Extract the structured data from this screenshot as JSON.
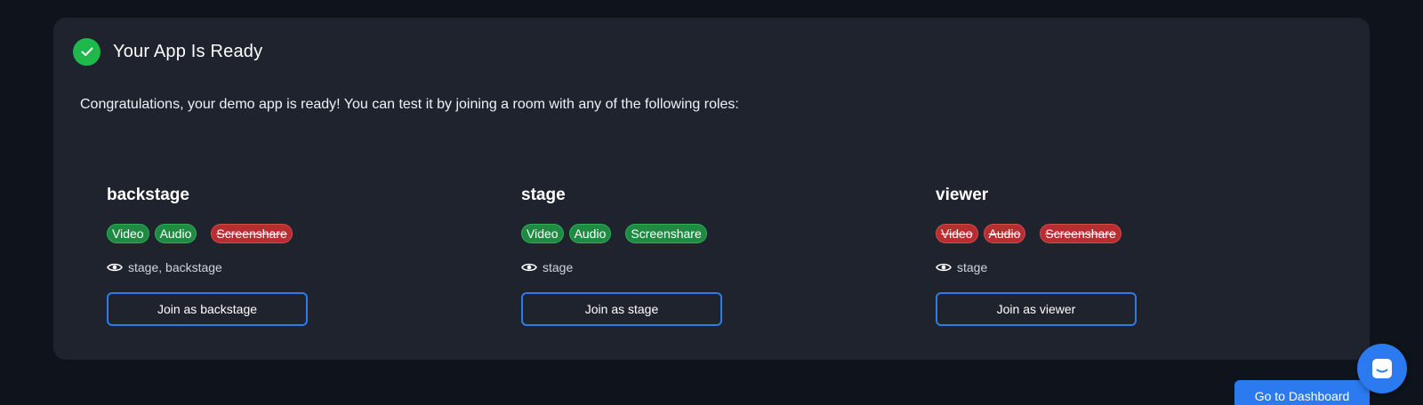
{
  "card": {
    "title": "Your App Is Ready",
    "description": "Congratulations, your demo app is ready! You can test it by joining a room with any of the following roles:"
  },
  "roles": [
    {
      "name": "backstage",
      "permissions": [
        {
          "label": "Video",
          "enabled": true
        },
        {
          "label": "Audio",
          "enabled": true
        },
        {
          "label": "Screenshare",
          "enabled": false
        }
      ],
      "visible_roles": "stage, backstage",
      "join_label": "Join as backstage"
    },
    {
      "name": "stage",
      "permissions": [
        {
          "label": "Video",
          "enabled": true
        },
        {
          "label": "Audio",
          "enabled": true
        },
        {
          "label": "Screenshare",
          "enabled": true
        }
      ],
      "visible_roles": "stage",
      "join_label": "Join as stage"
    },
    {
      "name": "viewer",
      "permissions": [
        {
          "label": "Video",
          "enabled": false
        },
        {
          "label": "Audio",
          "enabled": false
        },
        {
          "label": "Screenshare",
          "enabled": false
        }
      ],
      "visible_roles": "stage",
      "join_label": "Join as viewer"
    }
  ],
  "dashboard_button": {
    "label": "Go to Dashboard"
  },
  "icons": {
    "status": "check-circle-icon",
    "visibility": "eye-icon",
    "chat": "chat-launcher-icon"
  },
  "colors": {
    "background": "#0f131c",
    "card": "#1e232d",
    "enabled_badge": "#1f8a42",
    "disabled_badge": "#b72e31",
    "accent": "#2c7af0",
    "success": "#1fb84a"
  }
}
